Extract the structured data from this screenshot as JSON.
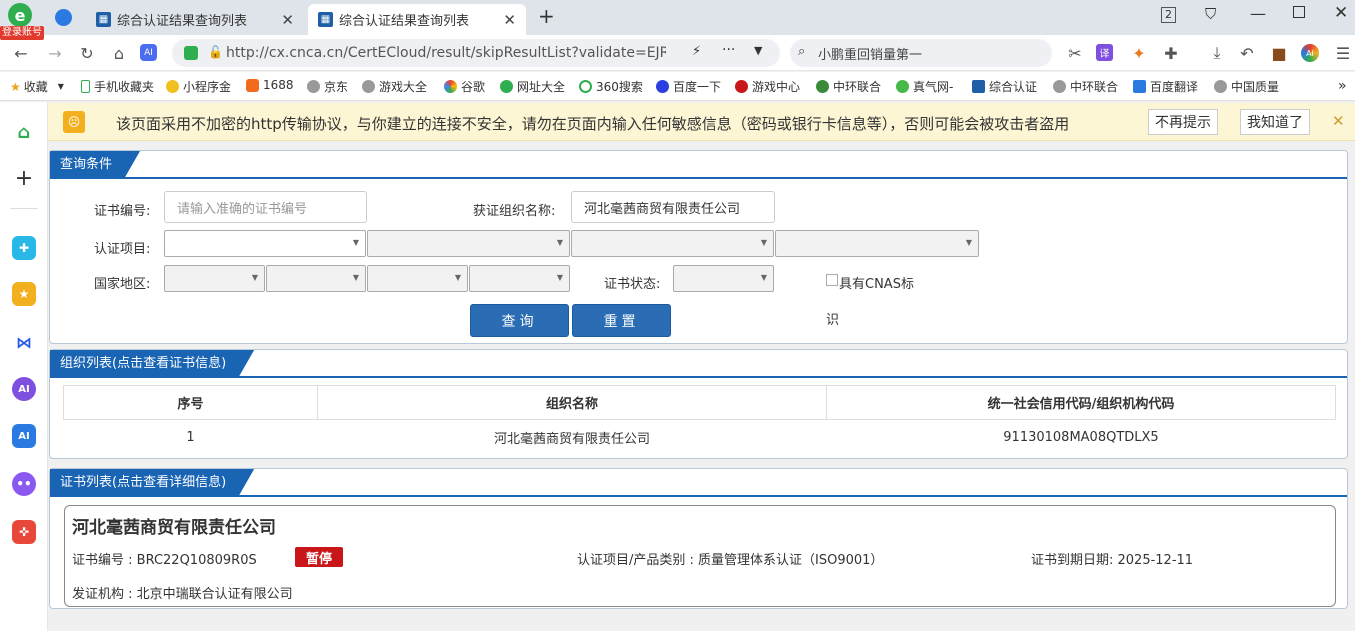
{
  "browser": {
    "login_label": "登录账号",
    "tabs": [
      {
        "label": "综合认证结果查询列表",
        "icon": "chart-icon"
      },
      {
        "label": "综合认证结果查询列表",
        "icon": "chart-icon"
      }
    ],
    "tab_count": "2",
    "url": "http://cx.cnca.cn/CertECloud/result/skipResultList?validate=EJRN&",
    "search_text": "小鹏重回销量第一",
    "bookmarks": [
      "收藏",
      "手机收藏夹",
      "小程序金",
      "1688",
      "京东",
      "游戏大全",
      "谷歌",
      "网址大全",
      "360搜索",
      "百度一下",
      "游戏中心",
      "中环联合",
      "真气网-",
      "综合认证",
      "中环联合",
      "百度翻译",
      "中国质量"
    ],
    "colors": {
      "accent": "#1a64b4",
      "badge": "#c91618",
      "warning_bg": "#fdf6d5"
    }
  },
  "warning": {
    "text": "该页面采用不加密的http传输协议，与你建立的连接不安全，请勿在页面内输入任何敏感信息（密码或银行卡信息等），否则可能会被攻击者盗用",
    "btn_dismiss": "不再提示",
    "btn_ok": "我知道了",
    "close": "✕"
  },
  "query": {
    "title": "查询条件",
    "cert_no_label": "证书编号:",
    "cert_no_placeholder": "请输入准确的证书编号",
    "org_label": "获证组织名称:",
    "org_value": "河北毫茜商贸有限责任公司",
    "project_label": "认证项目:",
    "region_label": "国家地区:",
    "status_label": "证书状态:",
    "cnas_label_1": "具有CNAS标",
    "cnas_label_2": "识",
    "search_btn": "查询",
    "reset_btn": "重置"
  },
  "org_list": {
    "title": "组织列表(点击查看证书信息)",
    "headers": [
      "序号",
      "组织名称",
      "统一社会信用代码/组织机构代码"
    ],
    "rows": [
      {
        "no": "1",
        "name": "河北毫茜商贸有限责任公司",
        "code": "91130108MA08QTDLX5"
      }
    ]
  },
  "cert_list": {
    "title": "证书列表(点击查看详细信息)",
    "org_name": "河北毫茜商贸有限责任公司",
    "cert_no": "证书编号 : BRC22Q10809R0S",
    "status": "暂停",
    "project": "认证项目/产品类别 : 质量管理体系认证（ISO9001）",
    "expiry": "证书到期日期: 2025-12-11",
    "issuer": "发证机构 : 北京中瑞联合认证有限公司"
  }
}
